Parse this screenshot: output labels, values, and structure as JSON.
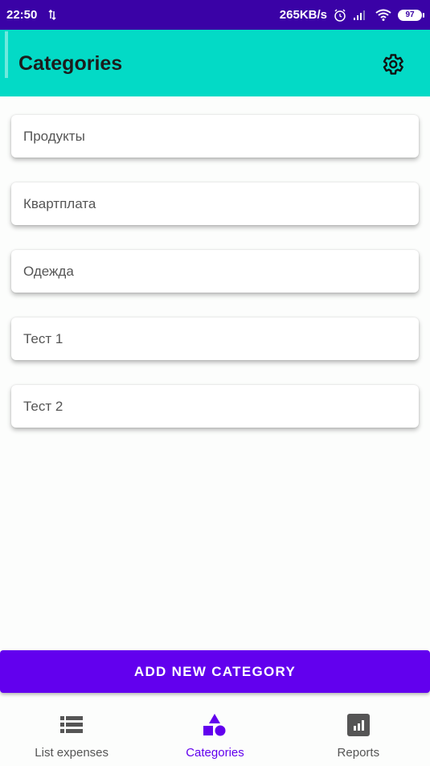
{
  "status_bar": {
    "time": "22:50",
    "speed": "265KB/s",
    "battery": "97"
  },
  "app_bar": {
    "title": "Categories",
    "color": "#03dac6"
  },
  "categories": [
    {
      "label": "Продукты"
    },
    {
      "label": "Квартплата"
    },
    {
      "label": "Одежда"
    },
    {
      "label": "Тест 1"
    },
    {
      "label": "Тест 2"
    }
  ],
  "add_button": {
    "label": "ADD NEW CATEGORY",
    "color": "#6200ee"
  },
  "bottom_nav": {
    "items": [
      {
        "label": "List expenses",
        "icon": "list-icon",
        "active": false
      },
      {
        "label": "Categories",
        "icon": "shapes-icon",
        "active": true
      },
      {
        "label": "Reports",
        "icon": "chart-icon",
        "active": false
      }
    ]
  }
}
